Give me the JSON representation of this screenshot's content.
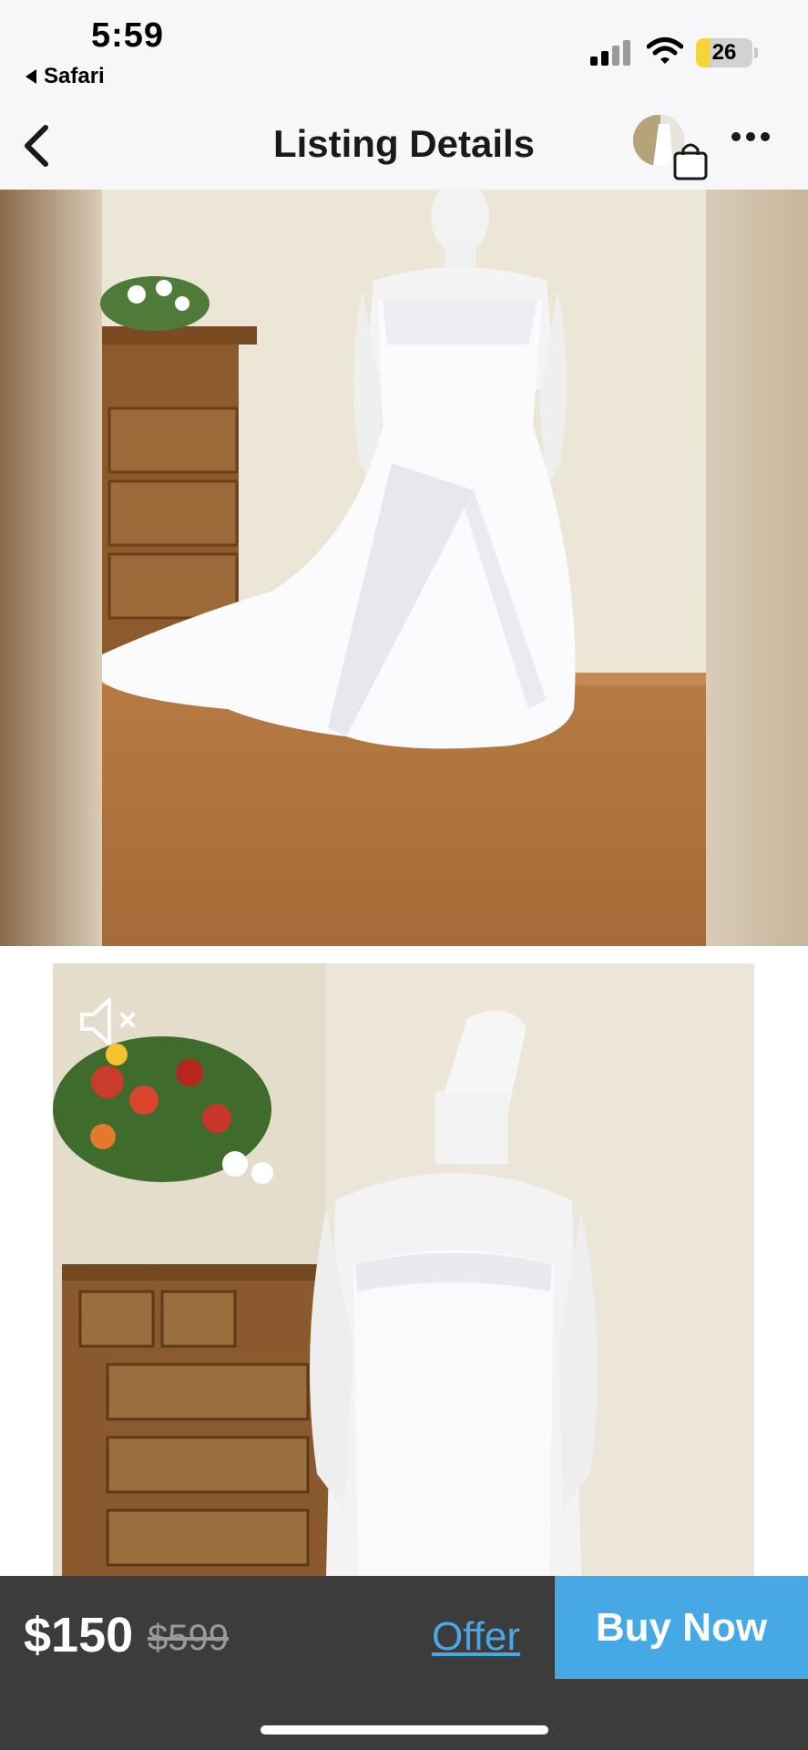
{
  "status_bar": {
    "time": "5:59",
    "back_app": "Safari",
    "battery": "26",
    "battery_level": 0.26,
    "icons": [
      "signal-icon",
      "wifi-icon",
      "battery-icon"
    ]
  },
  "header": {
    "title": "Listing Details",
    "icons": [
      "chevron-left-icon",
      "shopping-bag-icon",
      "more-icon"
    ]
  },
  "media": {
    "mute_icon": "speaker-muted-icon"
  },
  "purchase": {
    "price": "$150",
    "original_price": "$599",
    "offer_label": "Offer",
    "buy_now_label": "Buy Now"
  },
  "colors": {
    "accent": "#46a9e6",
    "bottom_bar": "#3c3c3c",
    "header_bg": "#f7f7f9",
    "battery_fill": "#f5d53a"
  }
}
